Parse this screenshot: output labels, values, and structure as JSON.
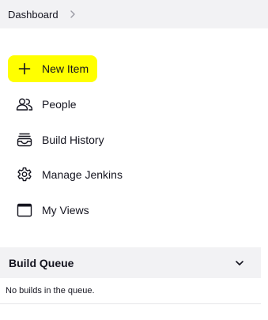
{
  "breadcrumb": {
    "items": [
      {
        "label": "Dashboard"
      }
    ]
  },
  "tasks": [
    {
      "label": "New Item",
      "icon": "plus-icon",
      "highlighted": true
    },
    {
      "label": "People",
      "icon": "people-icon"
    },
    {
      "label": "Build History",
      "icon": "build-history-icon"
    },
    {
      "label": "Manage Jenkins",
      "icon": "gear-icon"
    },
    {
      "label": "My Views",
      "icon": "window-icon"
    }
  ],
  "build_queue": {
    "title": "Build Queue",
    "empty_message": "No builds in the queue."
  },
  "colors": {
    "highlight": "#ffff00",
    "panel_background": "#f2f2f4",
    "text": "#14141f"
  }
}
